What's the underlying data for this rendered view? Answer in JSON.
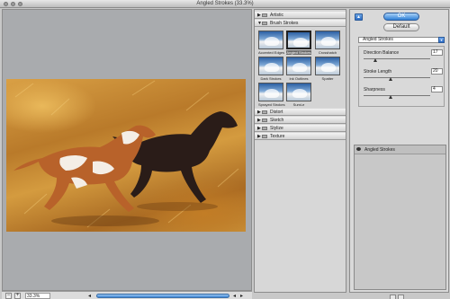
{
  "window": {
    "title": "Angled Strokes (33.3%)"
  },
  "preview": {
    "zoom_value": "33.3%",
    "zoom_minus": "−",
    "zoom_plus": "+"
  },
  "gallery": {
    "folders": [
      {
        "label": "Artistic",
        "expanded": false
      },
      {
        "label": "Brush Strokes",
        "expanded": true
      },
      {
        "label": "Distort",
        "expanded": false
      },
      {
        "label": "Sketch",
        "expanded": false
      },
      {
        "label": "Stylize",
        "expanded": false
      },
      {
        "label": "Texture",
        "expanded": false
      }
    ],
    "filters": [
      {
        "label": "Accented Edges",
        "selected": false
      },
      {
        "label": "Angled Strokes",
        "selected": true
      },
      {
        "label": "Crosshatch",
        "selected": false
      },
      {
        "label": "Dark Strokes",
        "selected": false
      },
      {
        "label": "Ink Outlines",
        "selected": false
      },
      {
        "label": "Spatter",
        "selected": false
      },
      {
        "label": "Sprayed Strokes",
        "selected": false
      },
      {
        "label": "Sumi-e",
        "selected": false
      }
    ]
  },
  "settings": {
    "ok_label": "OK",
    "default_label": "Default",
    "filter_selected": "Angled Strokes",
    "params": [
      {
        "label": "Direction Balance",
        "value": "17",
        "fraction": 0.17
      },
      {
        "label": "Stroke Length",
        "value": "20",
        "fraction": 0.4
      },
      {
        "label": "Sharpness",
        "value": "4",
        "fraction": 0.4
      }
    ]
  },
  "layers": {
    "items": [
      {
        "label": "Angled Strokes"
      }
    ]
  },
  "colors": {
    "accent": "#2f7fd6",
    "background": "#c8c8c8"
  }
}
